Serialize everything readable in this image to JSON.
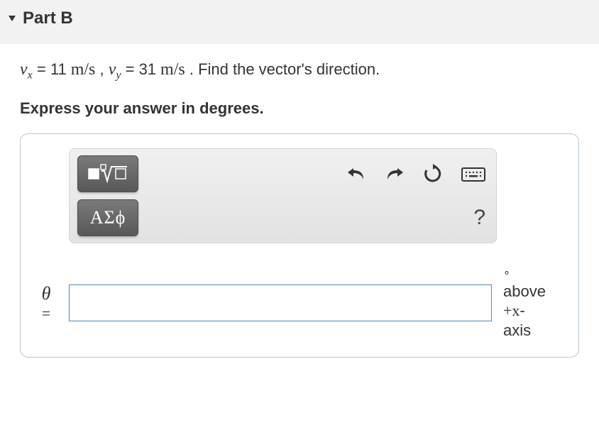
{
  "header": {
    "title": "Part B"
  },
  "question": {
    "vx_var": "v",
    "vx_sub": "x",
    "vx_eq": " = ",
    "vx_val": "11",
    "vx_unit": "  m/s",
    "sep": " , ",
    "vy_var": "v",
    "vy_sub": "y",
    "vy_eq": " = ",
    "vy_val": "31",
    "vy_unit": "  m/s",
    "tail": " . Find the vector's direction."
  },
  "instruction": "Express your answer in degrees.",
  "toolbar": {
    "greek_label": "ΑΣϕ",
    "help_label": "?"
  },
  "answer": {
    "theta": "θ",
    "eq": "=",
    "value": "",
    "placeholder": "",
    "unit_deg": "∘",
    "unit_above": "above",
    "unit_plusx": "+x",
    "unit_dash": "-",
    "unit_axis": "axis"
  }
}
